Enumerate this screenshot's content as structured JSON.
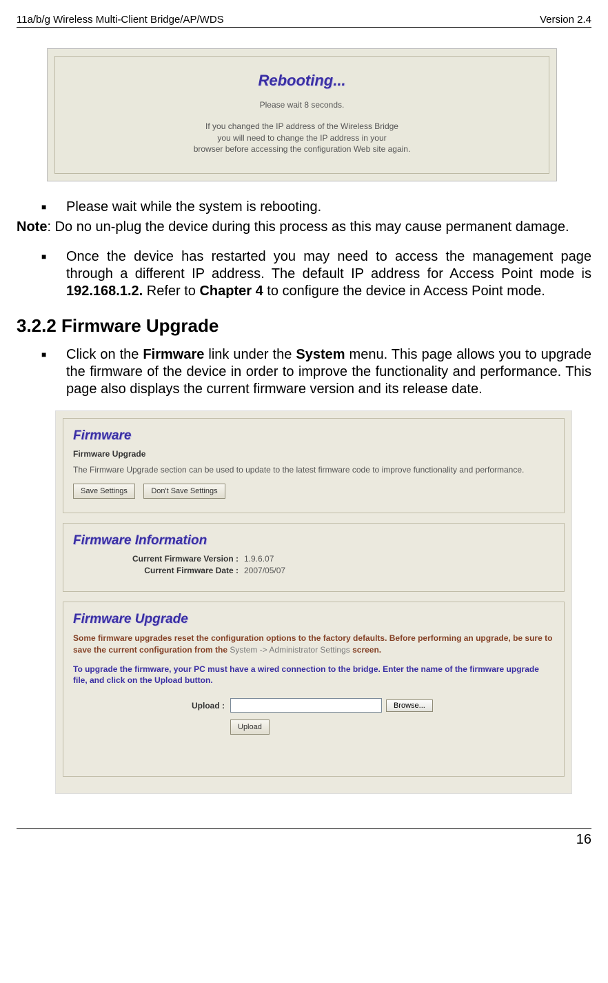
{
  "header": {
    "left": "11a/b/g Wireless Multi-Client Bridge/AP/WDS",
    "right": "Version 2.4"
  },
  "rebooting": {
    "title": "Rebooting...",
    "wait": "Please wait 8 seconds.",
    "msg1": "If you changed the IP address of the Wireless Bridge",
    "msg2": "you will need to change the IP address in your",
    "msg3": "browser before accessing the configuration Web site again."
  },
  "body": {
    "bullet1": "Please wait while the system is rebooting.",
    "note_label": "Note",
    "note_text": ": Do no un-plug the device during this process as this may cause permanent damage.",
    "bullet2_a": "Once the device has restarted you may need to access the management page through a different IP address. The default IP address for Access Point mode is ",
    "bullet2_ip": "192.168.1.2.",
    "bullet2_b": " Refer to ",
    "bullet2_ch": "Chapter 4",
    "bullet2_c": " to configure the device in Access Point mode.",
    "section": "3.2.2 Firmware Upgrade",
    "bullet3_a": "Click on the ",
    "bullet3_fw": "Firmware",
    "bullet3_b": " link under the ",
    "bullet3_sys": "System",
    "bullet3_c": " menu. This page allows you to upgrade the firmware of the device in order to improve the functionality and performance. This page also displays the current firmware version and its release date."
  },
  "fw": {
    "box1": {
      "title": "Firmware",
      "sub": "Firmware Upgrade",
      "desc": "The Firmware Upgrade section can be used to update to the latest firmware code to improve functionality and performance.",
      "save": "Save Settings",
      "dont": "Don't Save Settings"
    },
    "box2": {
      "title": "Firmware Information",
      "ver_label": "Current Firmware Version :",
      "ver_val": "1.9.6.07",
      "date_label": "Current Firmware Date :",
      "date_val": "2007/05/07"
    },
    "box3": {
      "title": "Firmware Upgrade",
      "warn_a": "Some firmware upgrades reset the configuration options to the factory defaults. Before performing an upgrade, be sure to save the current configuration from the ",
      "warn_link": "System -> Administrator Settings",
      "warn_b": " screen.",
      "instr": "To upgrade the firmware, your PC must have a wired connection to the bridge. Enter the name of the firmware upgrade file, and click on the Upload button.",
      "upload_label": "Upload :",
      "browse": "Browse...",
      "upload_btn": "Upload"
    }
  },
  "footer": {
    "page": "16"
  }
}
